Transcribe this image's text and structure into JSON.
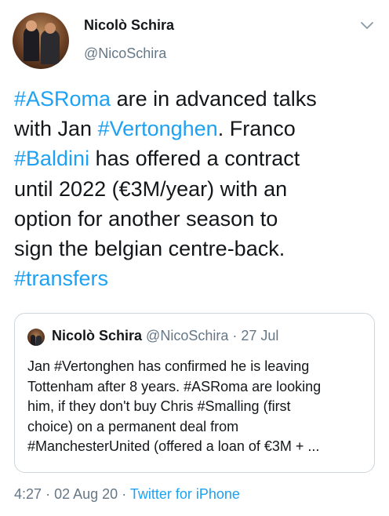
{
  "author": {
    "name": "Nicolò Schira",
    "handle": "@NicoSchira"
  },
  "tweet": {
    "lines": [
      [
        {
          "text": "#ASRoma",
          "hashtag": true
        },
        {
          "text": " are in advanced talks",
          "hashtag": false
        }
      ],
      [
        {
          "text": "with Jan ",
          "hashtag": false
        },
        {
          "text": "#Vertonghen",
          "hashtag": true
        },
        {
          "text": ". Franco",
          "hashtag": false
        }
      ],
      [
        {
          "text": "#Baldini",
          "hashtag": true
        },
        {
          "text": " has offered a contract",
          "hashtag": false
        }
      ],
      [
        {
          "text": "until 2022 (€3M/year) with an",
          "hashtag": false
        }
      ],
      [
        {
          "text": "option for another season to",
          "hashtag": false
        }
      ],
      [
        {
          "text": "sign the belgian centre-back.",
          "hashtag": false
        }
      ],
      [
        {
          "text": "#transfers",
          "hashtag": true
        }
      ]
    ]
  },
  "quoted_tweet": {
    "name": "Nicolò Schira",
    "handle": "@NicoSchira",
    "separator": "·",
    "date": "27 Jul",
    "lines": [
      "Jan #Vertonghen has confirmed  he is leaving",
      "Tottenham after 8 years. #ASRoma are looking",
      "him, if they don't buy Chris #Smalling (first",
      "choice) on a permanent deal from",
      "#ManchesterUnited (offered a loan of €3M + ..."
    ]
  },
  "footer": {
    "time": "4:27",
    "date": "02 Aug 20",
    "separator": "·",
    "source": "Twitter for iPhone"
  },
  "colors": {
    "link": "#1da1f2",
    "secondary_text": "#657786",
    "border": "#ccd6dd"
  },
  "icons": {
    "menu": "chevron-down-icon"
  }
}
